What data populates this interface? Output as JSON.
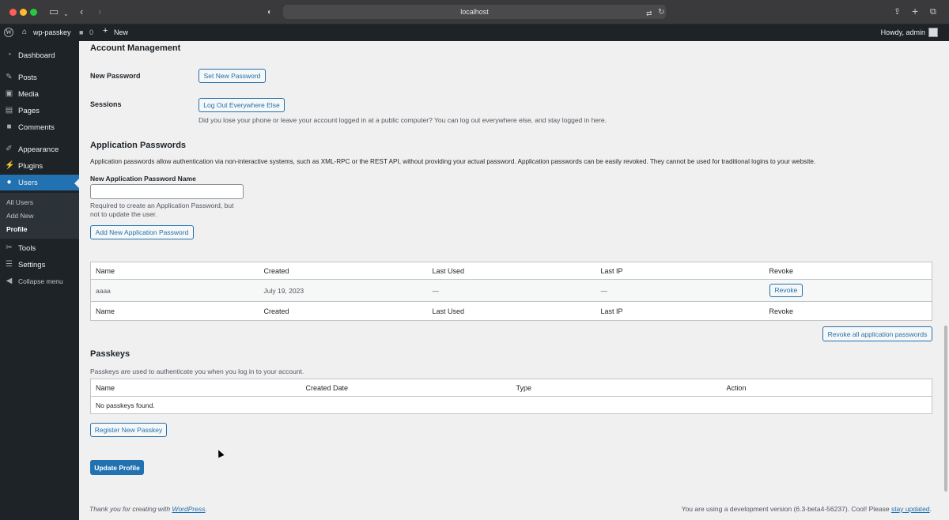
{
  "browser": {
    "url": "localhost"
  },
  "adminbar": {
    "site_name": "wp-passkey",
    "comments_count": "0",
    "new_label": "New",
    "howdy": "Howdy, admin"
  },
  "sidebar": {
    "items": [
      {
        "label": "Dashboard",
        "icon": "dashboard-icon"
      },
      {
        "label": "Posts",
        "icon": "pin-icon"
      },
      {
        "label": "Media",
        "icon": "media-icon"
      },
      {
        "label": "Pages",
        "icon": "pages-icon"
      },
      {
        "label": "Comments",
        "icon": "comment-icon"
      },
      {
        "label": "Appearance",
        "icon": "brush-icon"
      },
      {
        "label": "Plugins",
        "icon": "plug-icon"
      },
      {
        "label": "Users",
        "icon": "user-icon"
      },
      {
        "label": "Tools",
        "icon": "wrench-icon"
      },
      {
        "label": "Settings",
        "icon": "sliders-icon"
      },
      {
        "label": "Collapse menu",
        "icon": "collapse-icon"
      }
    ],
    "submenu": [
      "All Users",
      "Add New",
      "Profile"
    ]
  },
  "account": {
    "heading": "Account Management",
    "new_password_label": "New Password",
    "set_new_password_button": "Set New Password",
    "sessions_label": "Sessions",
    "logout_everywhere_button": "Log Out Everywhere Else",
    "sessions_desc": "Did you lose your phone or leave your account logged in at a public computer? You can log out everywhere else, and stay logged in here."
  },
  "app_passwords": {
    "heading": "Application Passwords",
    "desc": "Application passwords allow authentication via non-interactive systems, such as XML-RPC or the REST API, without providing your actual password. Application passwords can be easily revoked. They cannot be used for traditional logins to your website.",
    "name_label": "New Application Password Name",
    "name_value": "",
    "help_line1": "Required to create an Application Password, but",
    "help_line2": "not to update the user.",
    "add_button": "Add New Application Password",
    "columns": [
      "Name",
      "Created",
      "Last Used",
      "Last IP",
      "Revoke"
    ],
    "rows": [
      {
        "name": "aaaa",
        "created": "July 19, 2023",
        "last_used": "—",
        "last_ip": "—",
        "revoke": "Revoke"
      }
    ],
    "revoke_all_button": "Revoke all application passwords"
  },
  "passkeys": {
    "heading": "Passkeys",
    "desc": "Passkeys are used to authenticate you when you log in to your account.",
    "columns": [
      "Name",
      "Created Date",
      "Type",
      "Action"
    ],
    "empty_message": "No passkeys found.",
    "register_button": "Register New Passkey"
  },
  "update_button": "Update Profile",
  "footer": {
    "left_prefix": "Thank you for creating with ",
    "left_link": "WordPress",
    "left_suffix": ".",
    "right_prefix": "You are using a development version (6.3-beta4-56237). Cool! Please ",
    "right_link": "stay updated",
    "right_suffix": "."
  }
}
